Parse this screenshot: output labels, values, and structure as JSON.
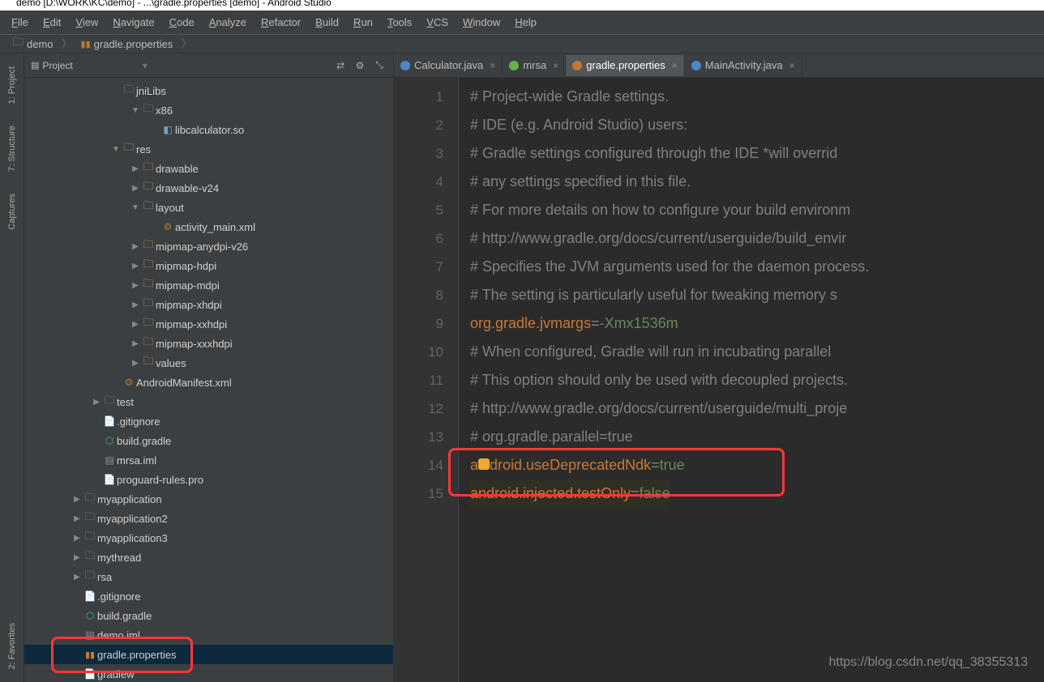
{
  "title": "demo [D:\\WORK\\KC\\demo] - ...\\gradle.properties [demo] - Android Studio",
  "menu": [
    "File",
    "Edit",
    "View",
    "Navigate",
    "Code",
    "Analyze",
    "Refactor",
    "Build",
    "Run",
    "Tools",
    "VCS",
    "Window",
    "Help"
  ],
  "breadcrumb": {
    "project": "demo",
    "file": "gradle.properties"
  },
  "side_tabs": [
    "1: Project",
    "7: Structure",
    "Captures",
    "2: Favorites"
  ],
  "project_panel_title": "Project",
  "tree": [
    {
      "indent": 4,
      "arrow": "",
      "icon": "folder",
      "label": "jniLibs"
    },
    {
      "indent": 5,
      "arrow": "▼",
      "icon": "folder",
      "label": "x86"
    },
    {
      "indent": 6,
      "arrow": "",
      "icon": "lib",
      "label": "libcalculator.so"
    },
    {
      "indent": 4,
      "arrow": "▼",
      "icon": "resfolder",
      "label": "res"
    },
    {
      "indent": 5,
      "arrow": "▶",
      "icon": "resfolder",
      "label": "drawable"
    },
    {
      "indent": 5,
      "arrow": "▶",
      "icon": "resfolder",
      "label": "drawable-v24"
    },
    {
      "indent": 5,
      "arrow": "▼",
      "icon": "resfolder",
      "label": "layout"
    },
    {
      "indent": 6,
      "arrow": "",
      "icon": "xml",
      "label": "activity_main.xml"
    },
    {
      "indent": 5,
      "arrow": "▶",
      "icon": "resfolder",
      "label": "mipmap-anydpi-v26"
    },
    {
      "indent": 5,
      "arrow": "▶",
      "icon": "resfolder",
      "label": "mipmap-hdpi"
    },
    {
      "indent": 5,
      "arrow": "▶",
      "icon": "resfolder",
      "label": "mipmap-mdpi"
    },
    {
      "indent": 5,
      "arrow": "▶",
      "icon": "resfolder",
      "label": "mipmap-xhdpi"
    },
    {
      "indent": 5,
      "arrow": "▶",
      "icon": "resfolder",
      "label": "mipmap-xxhdpi"
    },
    {
      "indent": 5,
      "arrow": "▶",
      "icon": "resfolder",
      "label": "mipmap-xxxhdpi"
    },
    {
      "indent": 5,
      "arrow": "▶",
      "icon": "resfolder",
      "label": "values"
    },
    {
      "indent": 4,
      "arrow": "",
      "icon": "xml",
      "label": "AndroidManifest.xml"
    },
    {
      "indent": 3,
      "arrow": "▶",
      "icon": "folder",
      "label": "test"
    },
    {
      "indent": 3,
      "arrow": "",
      "icon": "file",
      "label": ".gitignore"
    },
    {
      "indent": 3,
      "arrow": "",
      "icon": "gradle",
      "label": "build.gradle"
    },
    {
      "indent": 3,
      "arrow": "",
      "icon": "iml",
      "label": "mrsa.iml"
    },
    {
      "indent": 3,
      "arrow": "",
      "icon": "file",
      "label": "proguard-rules.pro"
    },
    {
      "indent": 2,
      "arrow": "▶",
      "icon": "folder",
      "label": "myapplication"
    },
    {
      "indent": 2,
      "arrow": "▶",
      "icon": "folder",
      "label": "myapplication2"
    },
    {
      "indent": 2,
      "arrow": "▶",
      "icon": "folder",
      "label": "myapplication3"
    },
    {
      "indent": 2,
      "arrow": "▶",
      "icon": "folder",
      "label": "mythread"
    },
    {
      "indent": 2,
      "arrow": "▶",
      "icon": "folder",
      "label": "rsa"
    },
    {
      "indent": 2,
      "arrow": "",
      "icon": "file",
      "label": ".gitignore"
    },
    {
      "indent": 2,
      "arrow": "",
      "icon": "gradle",
      "label": "build.gradle"
    },
    {
      "indent": 2,
      "arrow": "",
      "icon": "iml",
      "label": "demo.iml"
    },
    {
      "indent": 2,
      "arrow": "",
      "icon": "props",
      "label": "gradle.properties",
      "selected": true
    },
    {
      "indent": 2,
      "arrow": "",
      "icon": "file",
      "label": "gradlew"
    }
  ],
  "tabs": [
    {
      "label": "Calculator.java",
      "active": false,
      "color": "#4a88c7"
    },
    {
      "label": "mrsa",
      "active": false,
      "color": "#62b543"
    },
    {
      "label": "gradle.properties",
      "active": true,
      "color": "#c57633"
    },
    {
      "label": "MainActivity.java",
      "active": false,
      "color": "#4a88c7"
    }
  ],
  "code_lines": [
    {
      "n": 1,
      "style": "comment",
      "text": "# Project-wide Gradle settings."
    },
    {
      "n": 2,
      "style": "comment",
      "text": "# IDE (e.g. Android Studio) users:"
    },
    {
      "n": 3,
      "style": "comment",
      "text": "# Gradle settings configured through the IDE *will overrid"
    },
    {
      "n": 4,
      "style": "comment",
      "text": "# any settings specified in this file."
    },
    {
      "n": 5,
      "style": "comment",
      "text": "# For more details on how to configure your build environm"
    },
    {
      "n": 6,
      "style": "comment",
      "text": "# http://www.gradle.org/docs/current/userguide/build_envir"
    },
    {
      "n": 7,
      "style": "comment",
      "text": "# Specifies the JVM arguments used for the daemon process."
    },
    {
      "n": 8,
      "style": "comment",
      "text": "# The setting is particularly useful for tweaking memory s"
    },
    {
      "n": 9,
      "style": "kv",
      "key": "org.gradle.jvmargs",
      "val": "-Xmx1536m"
    },
    {
      "n": 10,
      "style": "comment",
      "text": "# When configured, Gradle will run in incubating parallel "
    },
    {
      "n": 11,
      "style": "comment",
      "text": "# This option should only be used with decoupled projects."
    },
    {
      "n": 12,
      "style": "comment",
      "text": "# http://www.gradle.org/docs/current/userguide/multi_proje"
    },
    {
      "n": 13,
      "style": "comment",
      "text": "# org.gradle.parallel=true"
    },
    {
      "n": 14,
      "style": "kv",
      "key": "android.useDeprecatedNdk",
      "val": "true",
      "bulb": true
    },
    {
      "n": 15,
      "style": "kv",
      "key": "android.injected.testOnly",
      "val": "false",
      "caret": true
    }
  ],
  "watermark": "https://blog.csdn.net/qq_38355313"
}
